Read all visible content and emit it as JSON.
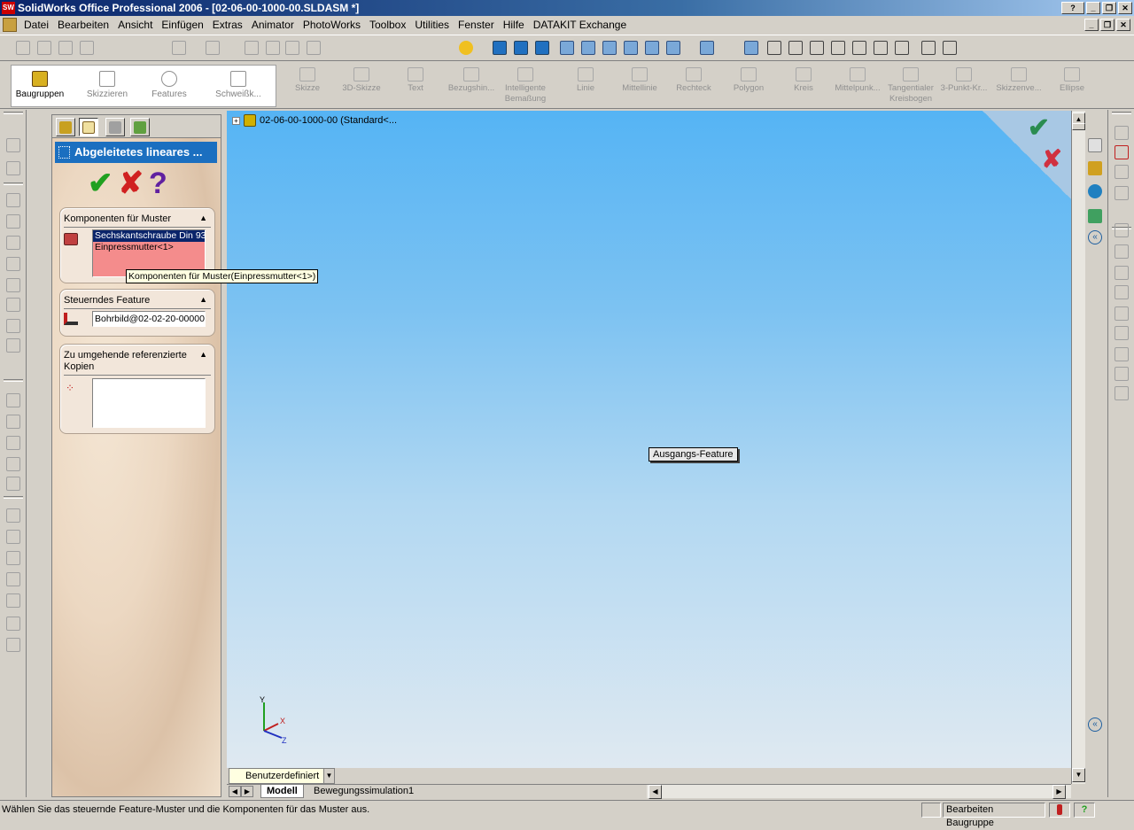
{
  "window": {
    "title": "SolidWorks Office Professional 2006 - [02-06-00-1000-00.SLDASM *]",
    "app_icon_text": "SW"
  },
  "menu": [
    "Datei",
    "Bearbeiten",
    "Ansicht",
    "Einfügen",
    "Extras",
    "Animator",
    "PhotoWorks",
    "Toolbox",
    "Utilities",
    "Fenster",
    "Hilfe",
    "DATAKIT Exchange"
  ],
  "command_manager": {
    "tabs": [
      {
        "label": "Baugruppen",
        "active": true
      },
      {
        "label": "Skizzieren",
        "active": false
      },
      {
        "label": "Features",
        "active": false
      },
      {
        "label": "Schweißk...",
        "active": false
      }
    ],
    "tools": [
      {
        "label": "Skizze"
      },
      {
        "label": "3D-Skizze"
      },
      {
        "label": "Text"
      },
      {
        "label": "Bezugshin..."
      },
      {
        "label": "Intelligente Bemaßung"
      },
      {
        "label": "Linie"
      },
      {
        "label": "Mittellinie"
      },
      {
        "label": "Rechteck"
      },
      {
        "label": "Polygon"
      },
      {
        "label": "Kreis"
      },
      {
        "label": "Mittelpunk..."
      },
      {
        "label": "Tangentialer Kreisbogen"
      },
      {
        "label": "3-Punkt-Kr..."
      },
      {
        "label": "Skizzenve..."
      },
      {
        "label": "Ellipse"
      }
    ]
  },
  "property_manager": {
    "title": "Abgeleitetes lineares ...",
    "ok_symbol": "✔",
    "cancel_symbol": "✘",
    "help_symbol": "?",
    "components_section": {
      "header": "Komponenten für Muster",
      "items": [
        "Sechskantschraube Din 93",
        "Einpressmutter<1>"
      ]
    },
    "driving_section": {
      "header": "Steuerndes Feature",
      "value": "Bohrbild@02-02-20-00000"
    },
    "skip_section": {
      "header_line1": "Zu umgehende referenzierte",
      "header_line2": "Kopien"
    },
    "tooltip": "Komponenten für Muster(Einpressmutter<1>)"
  },
  "viewport": {
    "tree_root": "02-06-00-1000-00  (Standard<...",
    "feature_label": "Ausgangs-Feature",
    "triad": {
      "x": "X",
      "y": "Y",
      "z": "Z"
    },
    "view_orientation": "Benutzerdefiniert"
  },
  "bottom_tabs": [
    {
      "label": "Modell",
      "active": true
    },
    {
      "label": "Bewegungssimulation1",
      "active": false
    }
  ],
  "status_bar": {
    "message": "Wählen Sie das steuernde Feature-Muster und die Komponenten für das Muster aus.",
    "mode": "Bearbeiten Baugruppe"
  },
  "colors": {
    "title_blue": "#0a246a",
    "pm_title": "#1b6fc0",
    "selection_pink": "#f48c8c",
    "viewport_top": "#55b4f4",
    "viewport_bottom": "#dfe9f1"
  }
}
